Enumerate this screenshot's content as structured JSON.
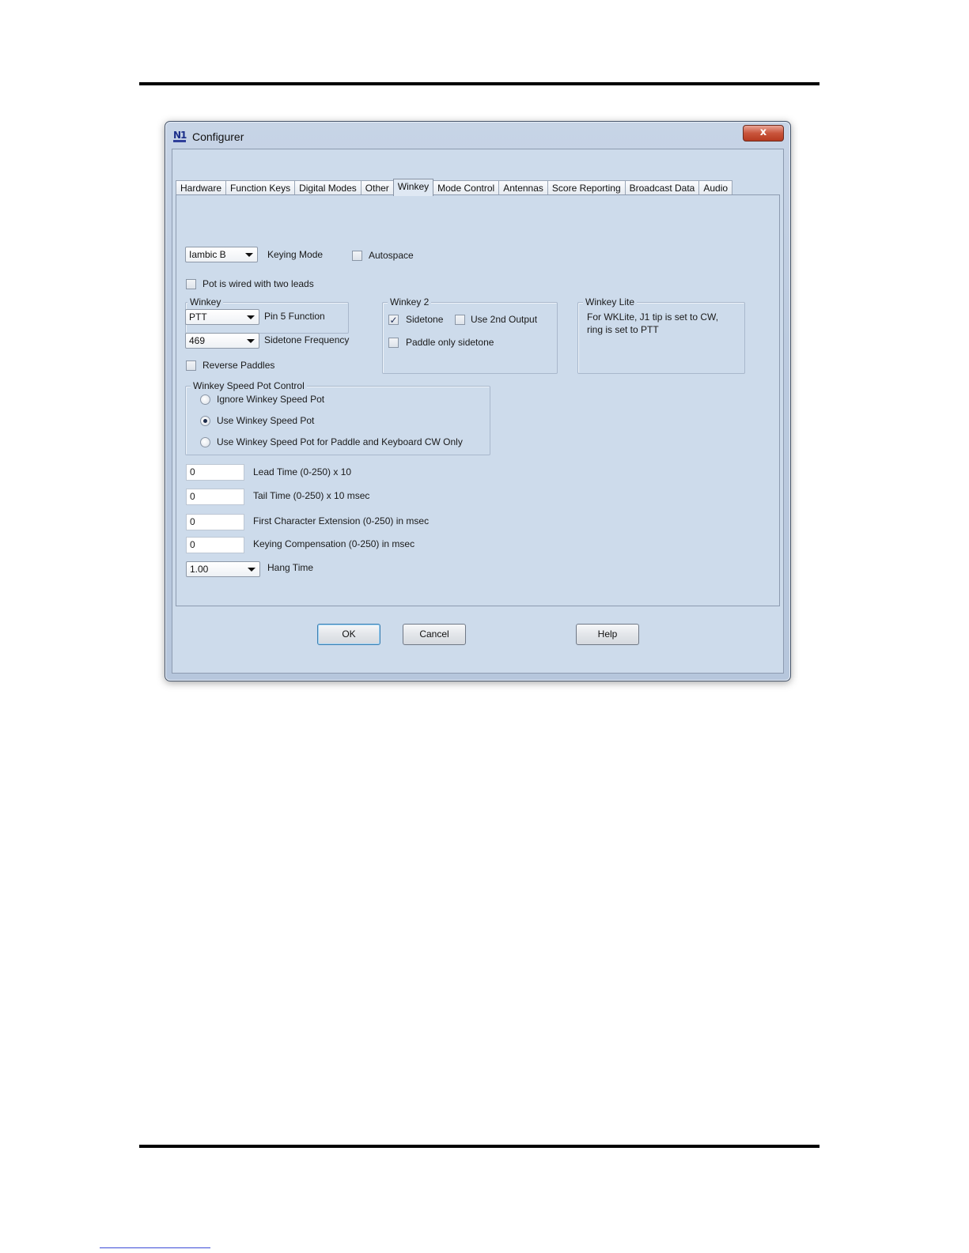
{
  "window": {
    "title": "Configurer",
    "close_label": "x"
  },
  "tabs": [
    "Hardware",
    "Function Keys",
    "Digital Modes",
    "Other",
    "Winkey",
    "Mode Control",
    "Antennas",
    "Score Reporting",
    "Broadcast Data",
    "Audio"
  ],
  "active_tab": "Winkey",
  "keying": {
    "mode_value": "Iambic B",
    "mode_label": "Keying Mode",
    "autospace_label": "Autospace",
    "autospace_checked": false,
    "pot_two_leads_label": "Pot is wired with two leads",
    "pot_two_leads_checked": false
  },
  "winkey": {
    "legend": "Winkey",
    "pin5_value": "PTT",
    "pin5_label": "Pin 5 Function",
    "sidetone_freq_value": "469",
    "sidetone_freq_label": "Sidetone Frequency",
    "reverse_paddles_label": "Reverse Paddles",
    "reverse_paddles_checked": false
  },
  "winkey2": {
    "legend": "Winkey 2",
    "sidetone_label": "Sidetone",
    "sidetone_checked": true,
    "use_2nd_output_label": "Use 2nd Output",
    "use_2nd_output_checked": false,
    "paddle_only_sidetone_label": "Paddle only sidetone",
    "paddle_only_sidetone_checked": false
  },
  "winkey_lite": {
    "legend": "Winkey Lite",
    "note_line1": "For WKLite, J1 tip is set to CW,",
    "note_line2": "ring is set to PTT"
  },
  "speed_pot": {
    "legend": "Winkey Speed Pot Control",
    "options": [
      {
        "label": "Ignore Winkey Speed Pot",
        "selected": false
      },
      {
        "label": "Use Winkey Speed Pot",
        "selected": true
      },
      {
        "label": "Use Winkey Speed Pot for Paddle and Keyboard CW Only",
        "selected": false
      }
    ]
  },
  "timing": {
    "lead_time_value": "0",
    "lead_time_label": "Lead Time (0-250) x 10",
    "tail_time_value": "0",
    "tail_time_label": "Tail Time (0-250) x 10 msec",
    "first_char_ext_value": "0",
    "first_char_ext_label": "First Character Extension (0-250) in msec",
    "keying_comp_value": "0",
    "keying_comp_label": "Keying Compensation (0-250) in msec",
    "hang_time_value": "1.00",
    "hang_time_label": "Hang Time"
  },
  "buttons": {
    "ok": "OK",
    "cancel": "Cancel",
    "help": "Help"
  },
  "icons": {
    "app": "n1mm-logo-icon",
    "checkmark": "✓"
  },
  "colors": {
    "panel_bg": "#cddbeb",
    "close_button": "#c9553c",
    "default_button_border": "#3c7fb1"
  }
}
